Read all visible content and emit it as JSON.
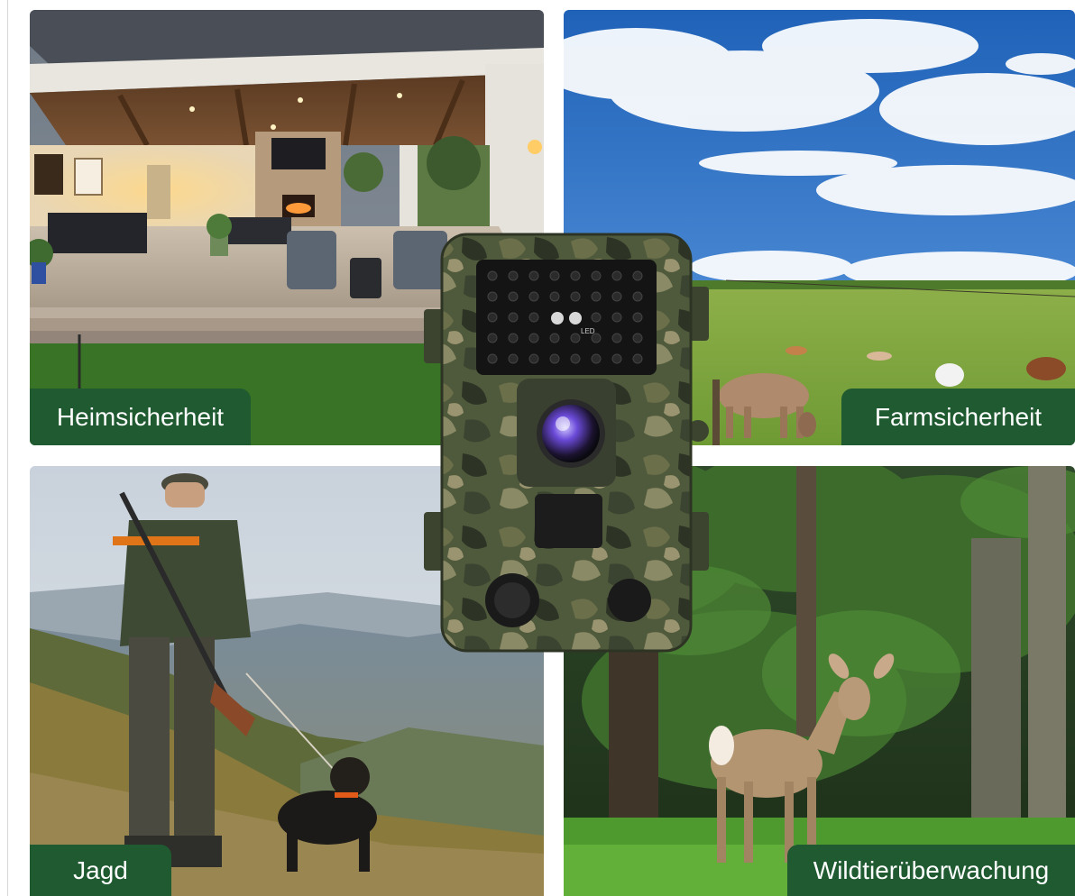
{
  "labels": {
    "home": "Heimsicherheit",
    "farm": "Farmsicherheit",
    "hunting": "Jagd",
    "wildlife": "Wildtierüberwachung"
  },
  "camera_badge": "LED",
  "colors": {
    "label_background": "#1f5a30",
    "label_text": "#ffffff",
    "camouflage_base": "#4f5a3c"
  },
  "icons": {
    "home": "house-patio-photo",
    "farm": "cattle-pasture-photo",
    "hunting": "hunter-with-dog-photo",
    "wildlife": "deer-in-forest-photo",
    "product": "trail-camera-photo"
  }
}
